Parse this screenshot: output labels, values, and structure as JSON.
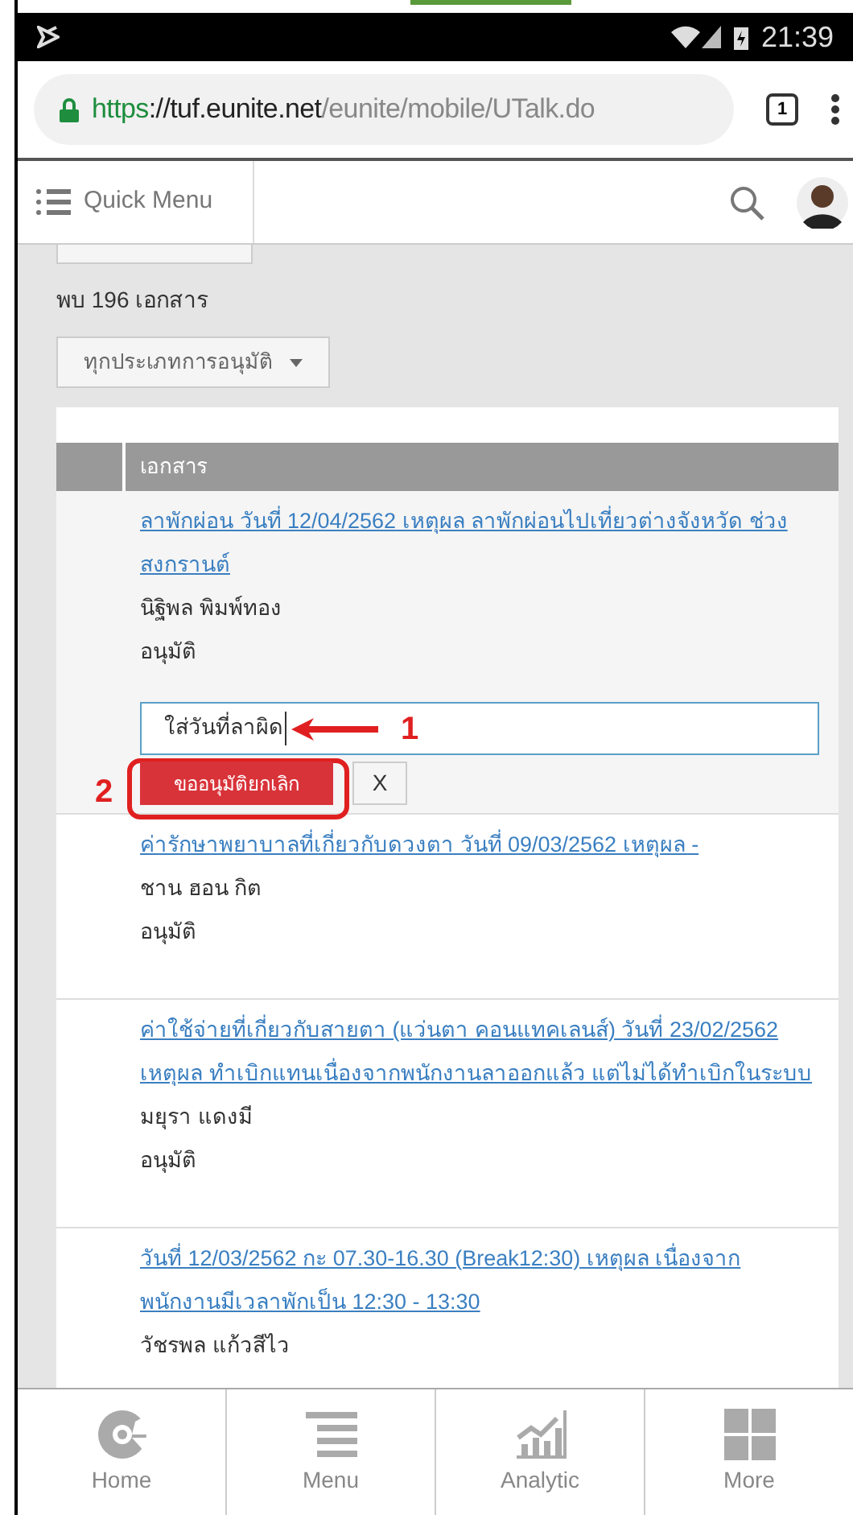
{
  "status_bar": {
    "time": "21:39"
  },
  "browser": {
    "url_scheme": "https",
    "url_host": "://tuf.eunite.net",
    "url_path": "/eunite/mobile/UTalk.do",
    "tab_count": "1"
  },
  "header": {
    "quick_menu": "Quick Menu"
  },
  "content": {
    "result_count": "พบ 196 เอกสาร",
    "filter": "ทุกประเภทการอนุมัติ",
    "column_header": "เอกสาร",
    "documents": [
      {
        "kind": "expanded",
        "title": "ลาพักผ่อน วันที่ 12/04/2562 เหตุผล ลาพักผ่อนไปเที่ยวต่างจังหวัด ช่วงสงกรานต์",
        "requester": "นิฐิพล พิมพ์ทอง",
        "status": "อนุมัติ",
        "reason_value": "ใส่วันที่ลาผิด",
        "submit_label": "ขออนุมัติยกเลิก",
        "close_label": "X"
      },
      {
        "kind": "plain",
        "title": "ค่ารักษาพยาบาลที่เกี่ยวกับดวงตา วันที่ 09/03/2562 เหตุผล -",
        "requester": "ชาน ฮอน กิต",
        "status": "อนุมัติ"
      },
      {
        "kind": "plain",
        "title": "ค่าใช้จ่ายที่เกี่ยวกับสายตา (แว่นตา คอนแทคเลนส์) วันที่ 23/02/2562 เหตุผล ทำเบิกแทนเนื่องจากพนักงานลาออกแล้ว แต่ไม่ได้ทำเบิกในระบบ",
        "requester": "มยุรา แดงมี",
        "status": "อนุมัติ"
      },
      {
        "kind": "plain",
        "title": "วันที่ 12/03/2562 กะ 07.30-16.30 (Break12:30) เหตุผล เนื่องจากพนักงานมีเวลาพักเป็น 12:30 - 13:30",
        "requester": "วัชรพล แก้วสีไว"
      }
    ]
  },
  "annotations": [
    {
      "label": "1"
    },
    {
      "label": "2"
    }
  ],
  "bottom_nav": [
    {
      "label": "Home",
      "kind": "home"
    },
    {
      "label": "Menu",
      "kind": "menu"
    },
    {
      "label": "Analytic",
      "kind": "analytic"
    },
    {
      "label": "More",
      "kind": "more"
    }
  ]
}
